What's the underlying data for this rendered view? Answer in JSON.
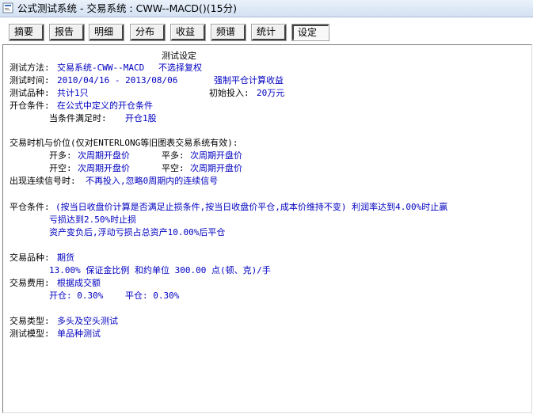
{
  "window": {
    "title": "公式测试系统 - 交易系统 : CWW--MACD()(15分)"
  },
  "tabs": [
    {
      "label": "摘要"
    },
    {
      "label": "报告"
    },
    {
      "label": "明细"
    },
    {
      "label": "分布"
    },
    {
      "label": "收益"
    },
    {
      "label": "频谱"
    },
    {
      "label": "统计"
    },
    {
      "label": "设定"
    }
  ],
  "settings": {
    "heading": "测试设定",
    "method_label": "测试方法:",
    "method_value": "交易系统-CWW--MACD",
    "method_extra": "不选择复权",
    "time_label": "测试时间:",
    "time_value": "2010/04/16 - 2013/08/06",
    "time_extra": "强制平仓计算收益",
    "symbols_label": "测试品种:",
    "symbols_value": "共计1只",
    "invest_label": "初始投入:",
    "invest_value": "20万元",
    "open_cond_label": "开仓条件:",
    "open_cond_value": "在公式中定义的开仓条件",
    "when_label": "当条件满足时:",
    "when_value": "开仓1股",
    "timing_label": "交易时机与价位(仅对ENTERLONG等旧图表交易系统有效):",
    "open_long_label": "开多:",
    "open_long_value": "次周期开盘价",
    "close_long_label": "平多:",
    "close_long_value": "次周期开盘价",
    "open_short_label": "开空:",
    "open_short_value": "次周期开盘价",
    "close_short_label": "平空:",
    "close_short_value": "次周期开盘价",
    "consec_label": "出现连续信号时:",
    "consec_value": "不再投入,忽略0周期内的连续信号",
    "close_cond_label": "平仓条件:",
    "close_cond_line1": "(按当日收盘价计算是否满足止损条件,按当日收盘价平仓,成本价维持不变)   利润率达到4.00%时止赢",
    "close_cond_line2": "亏损达到2.50%时止损",
    "close_cond_line3": "资产变负后,浮动亏损占总资产10.00%后平仓",
    "variety_label": "交易品种:",
    "variety_value": "期货",
    "margin_value": "13.00% 保证金比例        和约单位 300.00 点(顿、克)/手",
    "fee_label": "交易费用:",
    "fee_value": "根据成交额",
    "fee_open": "开仓: 0.30%",
    "fee_close": "平仓: 0.30%",
    "type_label": "交易类型:",
    "type_value": "多头及空头测试",
    "model_label": "测试模型:",
    "model_value": "单品种测试"
  },
  "colors": {
    "value_text": "#0000c0",
    "label_text": "#000000"
  },
  "icons": {
    "app": "app-icon"
  }
}
